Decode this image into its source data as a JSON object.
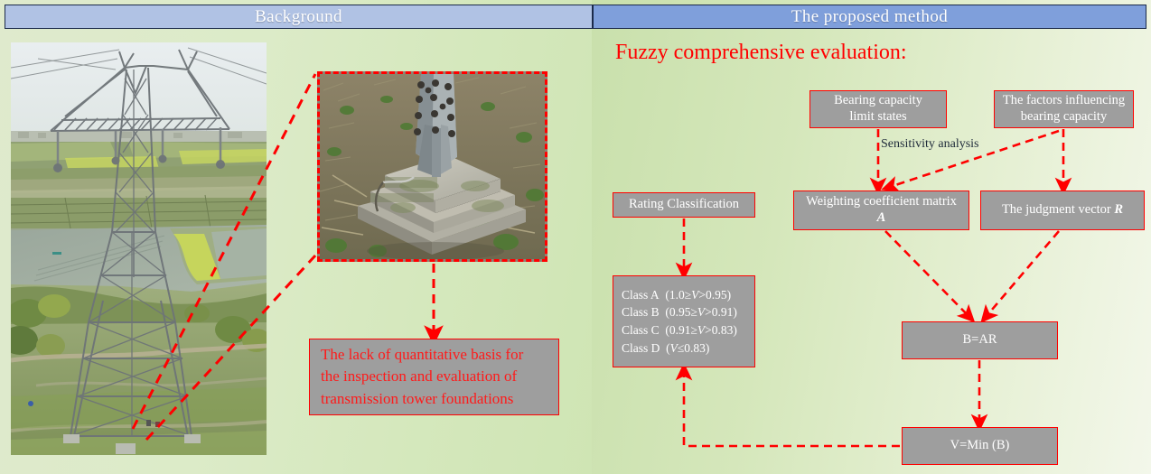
{
  "header": {
    "left_title": "Background",
    "right_title": "The proposed method",
    "left_color": "#b0c2e4",
    "right_color": "#7f9fdb"
  },
  "section": {
    "title": "Fuzzy comprehensive evaluation:",
    "title_color": "#ff0000"
  },
  "background_panel": {
    "main_photo_alt": "Aerial photograph of a lattice steel transmission tower over farmland and ponds",
    "detail_photo_alt": "Close-up photograph of a concrete transmission tower foundation with bolted steel leg",
    "problem_statement": [
      "The lack of quantitative basis for",
      "the inspection and evaluation of",
      "transmission tower foundations"
    ],
    "problem_text_color": "#ff1a1a"
  },
  "flowchart": {
    "box_fill": "#9e9e9e",
    "box_border": "#ff0000",
    "arrow_color": "#ff0000",
    "nodes": {
      "bearing_limit": [
        "Bearing capacity",
        "limit states"
      ],
      "factors": [
        "The factors influencing",
        "bearing capacity"
      ],
      "rating": "Rating Classification",
      "weighting": [
        "Weighting coefficient matrix",
        "A"
      ],
      "judgment": [
        "The judgment vector ",
        "R"
      ],
      "b_eq": "B=AR",
      "v_min": "V=Min (B)"
    },
    "edge_label": "Sensitivity analysis",
    "edge_label_color": "#1e2a3a",
    "classes": [
      {
        "name": "Class A",
        "range_pre": "(1.0≥",
        "var": "V",
        "range_post": ">0.95)"
      },
      {
        "name": "Class B",
        "range_pre": "(0.95≥",
        "var": "V",
        "range_post": ">0.91)"
      },
      {
        "name": "Class C",
        "range_pre": "(0.91≥",
        "var": "V",
        "range_post": ">0.83)"
      },
      {
        "name": "Class D",
        "range_pre": "(",
        "var": "V",
        "range_post": "≤0.83)"
      }
    ]
  }
}
